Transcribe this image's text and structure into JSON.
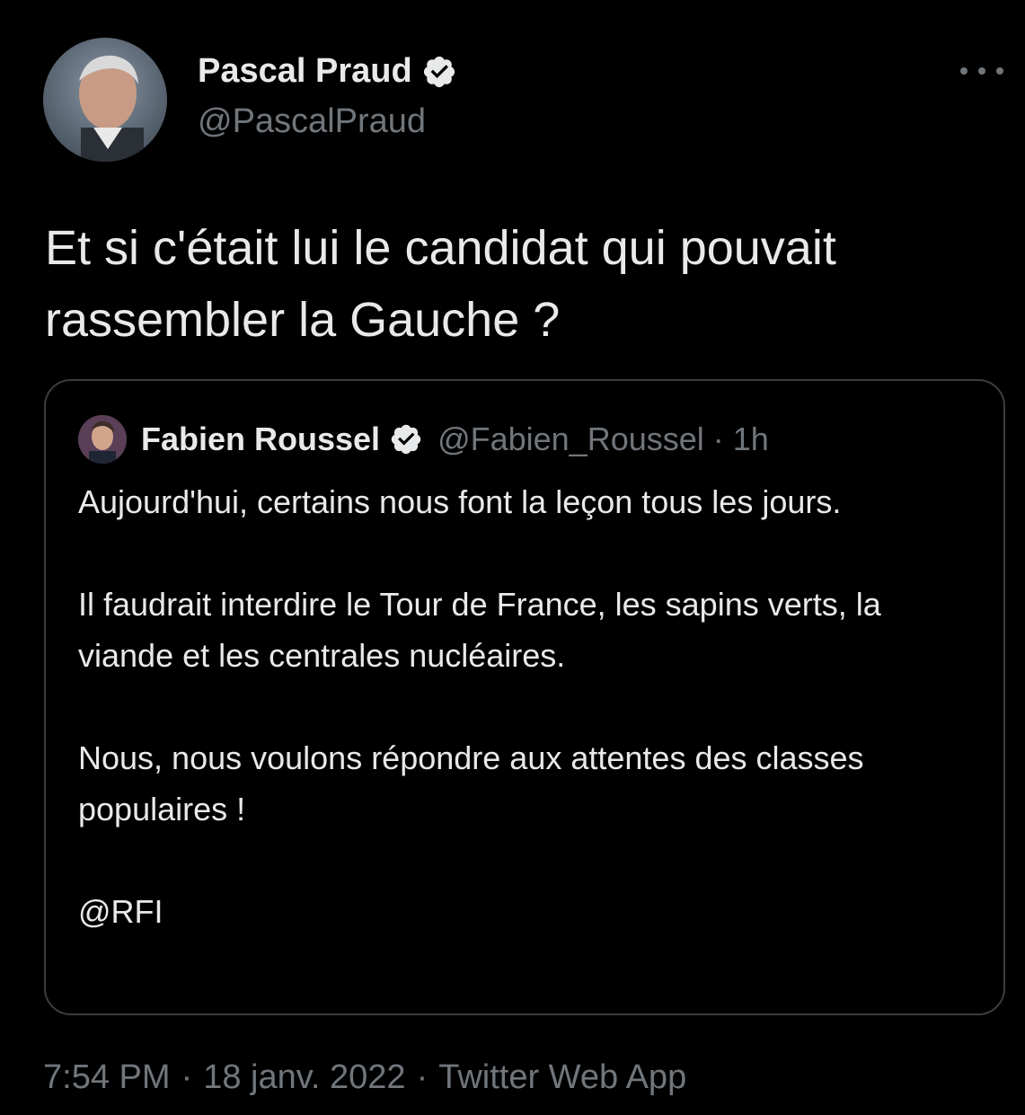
{
  "tweet": {
    "author": {
      "name": "Pascal Praud",
      "handle": "@PascalPraud",
      "verified": true,
      "avatar_icon": "avatar-photo"
    },
    "text": "Et si c'était lui le candidat qui pouvait rassembler la Gauche ?",
    "more_icon": "more-horizontal-icon",
    "quoted": {
      "author": {
        "name": "Fabien Roussel",
        "handle": "@Fabien_Roussel",
        "dot": "·",
        "time": "1h",
        "verified": true
      },
      "paragraphs": [
        "Aujourd'hui, certains nous font la leçon tous les jours.",
        "Il faudrait interdire le Tour de France, les sapins verts, la viande et les centrales nucléaires.",
        "Nous, nous voulons répondre aux attentes des classes populaires !",
        "@RFI"
      ]
    },
    "meta": {
      "time": "7:54 PM",
      "sep1": "·",
      "date": "18 janv. 2022",
      "sep2": "·",
      "source": "Twitter Web App"
    }
  },
  "colors": {
    "background": "#000000",
    "text_primary": "#e7e9ea",
    "text_secondary": "#71767b",
    "border": "#3a3d40",
    "verified_badge": "#e7e9ea"
  }
}
